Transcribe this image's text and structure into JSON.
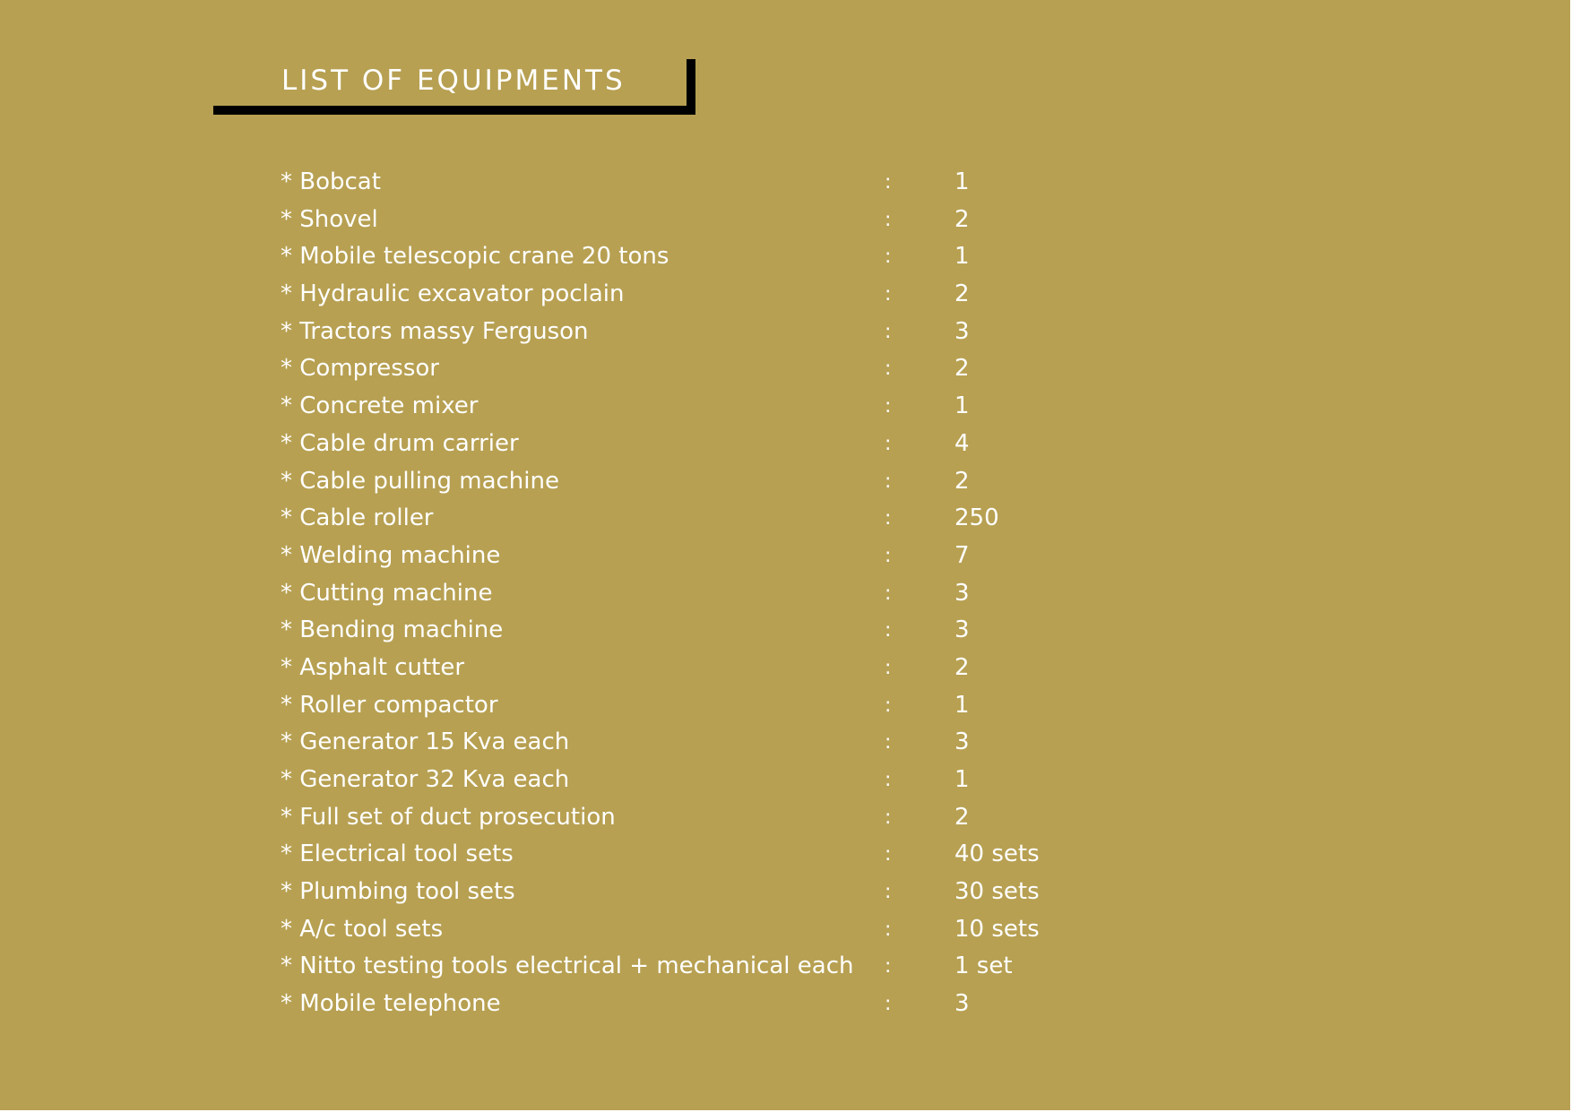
{
  "title": "LIST OF EQUIPMENTS",
  "separator": ":",
  "items": [
    {
      "name": "* Bobcat",
      "qty": "1"
    },
    {
      "name": "* Shovel",
      "qty": "2"
    },
    {
      "name": "* Mobile telescopic crane 20 tons",
      "qty": "1"
    },
    {
      "name": "* Hydraulic excavator poclain",
      "qty": "2"
    },
    {
      "name": "* Tractors massy Ferguson",
      "qty": "3"
    },
    {
      "name": "* Compressor",
      "qty": "2"
    },
    {
      "name": "* Concrete mixer",
      "qty": "1"
    },
    {
      "name": "* Cable drum carrier",
      "qty": "4"
    },
    {
      "name": "* Cable pulling machine",
      "qty": "2"
    },
    {
      "name": "* Cable roller",
      "qty": "250"
    },
    {
      "name": "* Welding machine",
      "qty": "7"
    },
    {
      "name": "* Cutting machine",
      "qty": "3"
    },
    {
      "name": "* Bending machine",
      "qty": "3"
    },
    {
      "name": "* Asphalt cutter",
      "qty": "2"
    },
    {
      "name": "* Roller compactor",
      "qty": "1"
    },
    {
      "name": "* Generator 15 Kva each",
      "qty": "3"
    },
    {
      "name": "* Generator 32 Kva each",
      "qty": "1"
    },
    {
      "name": "* Full set of duct prosecution",
      "qty": "2"
    },
    {
      "name": "* Electrical tool sets",
      "qty": "40 sets"
    },
    {
      "name": "* Plumbing tool sets",
      "qty": "30 sets"
    },
    {
      "name": "* A/c tool sets",
      "qty": "10 sets"
    },
    {
      "name": "* Nitto testing tools electrical + mechanical each",
      "qty": "1 set"
    },
    {
      "name": "* Mobile telephone",
      "qty": "3"
    }
  ],
  "colors": {
    "background": "#b7a052",
    "text": "#ffffff",
    "accent_bar": "#000000"
  }
}
